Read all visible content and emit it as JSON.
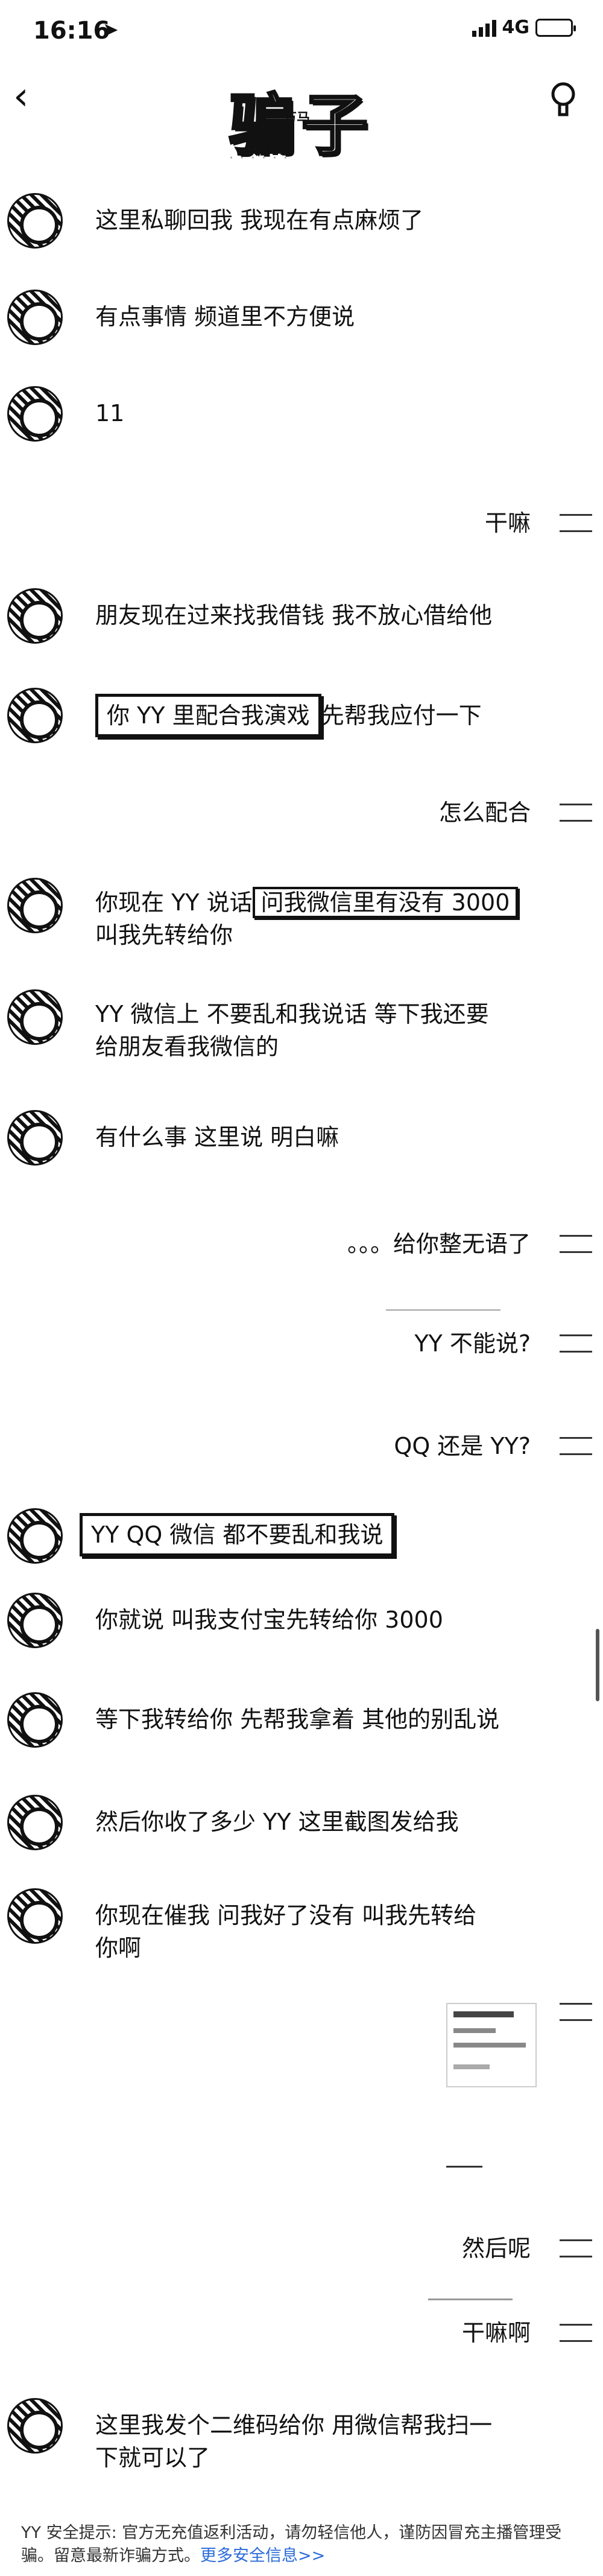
{
  "status_bar": {
    "time": "16:16",
    "network": "4G"
  },
  "nav": {
    "title": "骗子",
    "title_mark": "万马",
    "subtitle": "· · · · · ·"
  },
  "messages": [
    {
      "side": "left",
      "text": "这里私聊回我 我现在有点麻烦了"
    },
    {
      "side": "left",
      "text": "有点事情 频道里不方便说"
    },
    {
      "side": "left",
      "text": "11"
    },
    {
      "side": "right",
      "text": "干嘛"
    },
    {
      "side": "left",
      "text": "朋友现在过来找我借钱 我不放心借给他"
    },
    {
      "side": "left",
      "boxed": "你 YY 里配合我演戏",
      "rest": "先帮我应付一下"
    },
    {
      "side": "right",
      "text": "怎么配合"
    },
    {
      "side": "left",
      "pre": "你现在 YY 说话",
      "boxed": "问我微信里有没有 3000",
      "line2": "叫我先转给你"
    },
    {
      "side": "left",
      "text": "YY 微信上 不要乱和我说话 等下我还要",
      "line2": "给朋友看我微信的"
    },
    {
      "side": "left",
      "text": "有什么事 这里说 明白嘛"
    },
    {
      "side": "right",
      "text": "。。。给你整无语了"
    },
    {
      "side": "right",
      "text": "YY 不能说?"
    },
    {
      "side": "right",
      "text": "QQ 还是 YY?"
    },
    {
      "side": "left",
      "boxed": "YY QQ 微信 都不要乱和我说"
    },
    {
      "side": "left",
      "text": "你就说 叫我支付宝先转给你 3000"
    },
    {
      "side": "left",
      "text": "等下我转给你 先帮我拿着 其他的别乱说"
    },
    {
      "side": "left",
      "text": "然后你收了多少 YY 这里截图发给我"
    },
    {
      "side": "left",
      "text": "你现在催我 问我好了没有 叫我先转给",
      "line2": "你啊"
    },
    {
      "side": "right",
      "text": "然后呢"
    },
    {
      "side": "right",
      "text": "干嘛啊"
    },
    {
      "side": "left",
      "text": "这里我发个二维码给你 用微信帮我扫一",
      "line2": "下就可以了"
    }
  ],
  "footer": {
    "label": "YY 安全提示:",
    "text": "官方无充值返利活动，请勿轻信他人，谨防因冒充主播管理受骗。留意最新诈骗方式。",
    "more": "更多安全信息>>"
  }
}
